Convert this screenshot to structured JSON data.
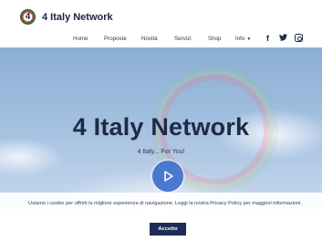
{
  "header": {
    "brand_logo_text": "4",
    "brand_name": "4 Italy Network"
  },
  "nav": {
    "items": [
      "Home",
      "Proposte",
      "Novità",
      "Servizi",
      "Shop"
    ],
    "info_label": "Info",
    "social_icons": [
      "facebook-icon",
      "twitter-icon",
      "instagram-icon"
    ]
  },
  "hero": {
    "title": "4 Italy Network",
    "subtitle": "4 Italy... For You!",
    "play_icon": "play-icon"
  },
  "cookie": {
    "text": "Usiamo i cookie per offrirti la migliore esperienza di navigazione. Leggi la nostra Privacy Policy per maggiori informazioni.",
    "accept_label": "Accetto"
  },
  "colors": {
    "brand_navy": "#1d2d57",
    "play_blue": "#4a78d0",
    "sky": "#a8c3e2"
  }
}
